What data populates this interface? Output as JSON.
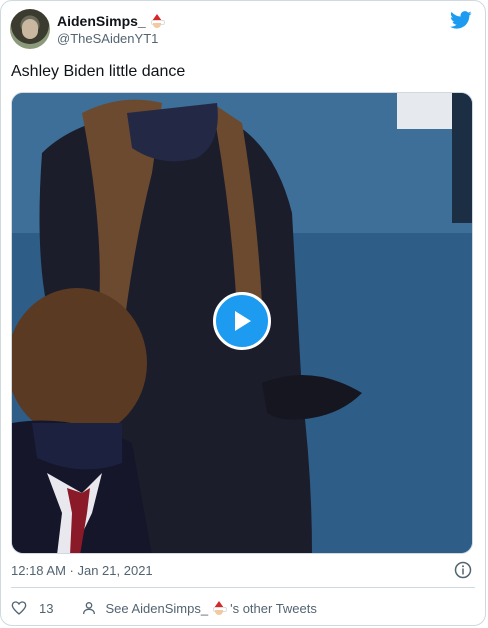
{
  "user": {
    "display_name": "AidenSimps_",
    "handle": "@TheSAidenYT1",
    "emoji": "santa-emoji"
  },
  "tweet": {
    "text": "Ashley Biden little dance",
    "timestamp": "12:18 AM · Jan 21, 2021"
  },
  "media": {
    "type": "video",
    "play_icon": "play-icon"
  },
  "actions": {
    "like_count": "13",
    "see_prefix": "See AidenSimps_",
    "see_suffix": "'s other Tweets"
  },
  "colors": {
    "brand": "#1d9bf0",
    "text": "#0f1419",
    "muted": "#536471",
    "border": "#cfd9de"
  }
}
